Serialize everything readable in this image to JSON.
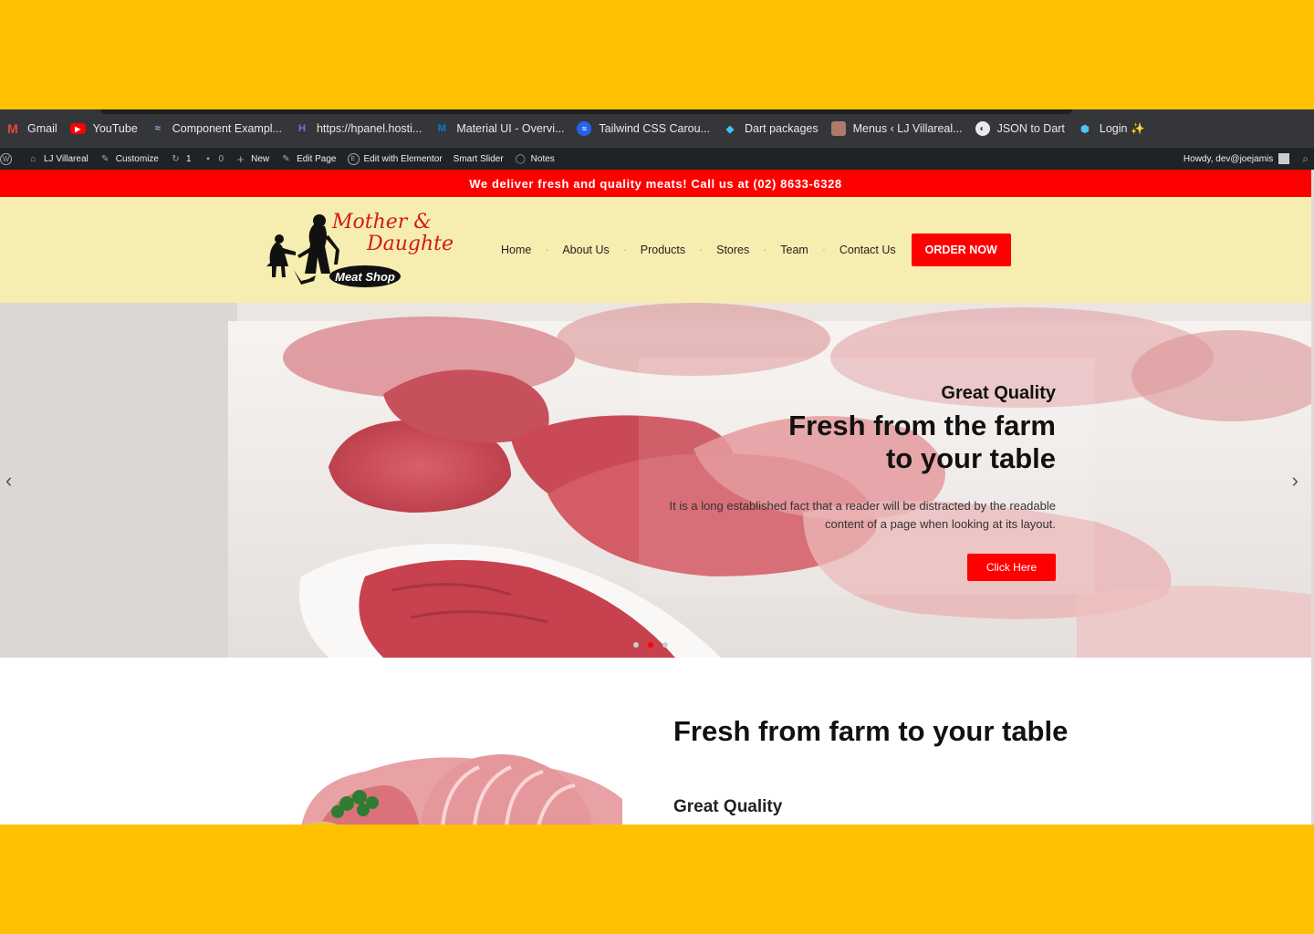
{
  "bookmarks": [
    {
      "label": "Gmail",
      "icon": "gmail-icon"
    },
    {
      "label": "YouTube",
      "icon": "youtube-icon"
    },
    {
      "label": "Component Exampl...",
      "icon": "component-icon"
    },
    {
      "label": "https://hpanel.hosti...",
      "icon": "hostinger-icon"
    },
    {
      "label": "Material UI - Overvi...",
      "icon": "material-ui-icon"
    },
    {
      "label": "Tailwind CSS Carou...",
      "icon": "tailwind-icon"
    },
    {
      "label": "Dart packages",
      "icon": "dart-icon"
    },
    {
      "label": "Menus ‹ LJ Villareal...",
      "icon": "menus-icon"
    },
    {
      "label": "JSON to Dart",
      "icon": "globe-icon"
    },
    {
      "label": "Login ✨",
      "icon": "login-icon"
    }
  ],
  "adminbar": {
    "site": "LJ Villareal",
    "customize": "Customize",
    "updates": "1",
    "comments": "0",
    "new": "New",
    "edit_page": "Edit Page",
    "elementor": "Edit with Elementor",
    "smart_slider": "Smart Slider",
    "notes": "Notes",
    "howdy": "Howdy, dev@joejamis"
  },
  "promo": "We deliver fresh and quality meats! Call us at (02) 8633-6328",
  "logo": {
    "line1": "Mother &",
    "line2": "Daughter",
    "badge": "Meat Shop"
  },
  "nav": [
    "Home",
    "About Us",
    "Products",
    "Stores",
    "Team",
    "Contact Us"
  ],
  "order_button": "ORDER NOW",
  "hero": {
    "subtitle": "Great Quality",
    "title_line1": "Fresh from the farm",
    "title_line2": "to your table",
    "description": "It is a long established fact that a reader will be distracted by the readable content of a page when looking at its layout.",
    "button": "Click Here",
    "active_slide": 2,
    "slide_count": 3
  },
  "section": {
    "title": "Fresh from farm to your table",
    "subtitle": "Great Quality"
  },
  "colors": {
    "accent": "#ff0000",
    "header_bg": "#f6edb0",
    "outer_bg": "#FFC000"
  }
}
